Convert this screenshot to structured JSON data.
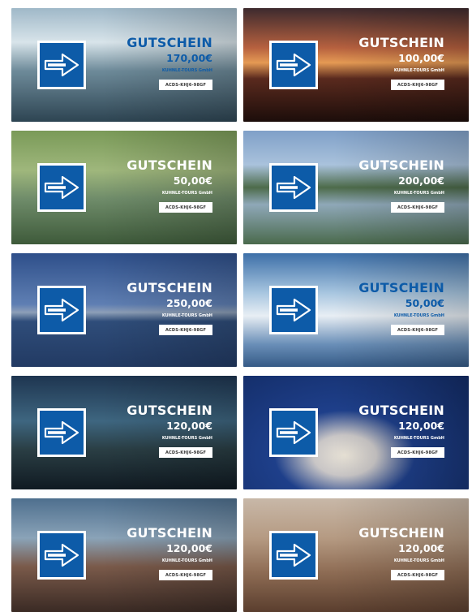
{
  "cards": [
    {
      "title": "GUTSCHEIN",
      "amount": "170,00€",
      "company": "KUHNLE-TOURS GmbH",
      "code": "ACDS-KHJ6-98GF",
      "text_color": "#0d5ba8",
      "bg": "linear-gradient(180deg,#9fb8c8 0%,#d8e4ea 30%,#6e8b9a 55%,#2d4452 100%)"
    },
    {
      "title": "GUTSCHEIN",
      "amount": "100,00€",
      "company": "KUHNLE-TOURS GmbH",
      "code": "ACDS-KHJ6-98GF",
      "text_color": "#ffffff",
      "bg": "linear-gradient(180deg,#3d2a2e 0%,#b7613f 35%,#e59a54 48%,#5a2a1e 62%,#1c0d0a 100%)"
    },
    {
      "title": "GUTSCHEIN",
      "amount": "50,00€",
      "company": "KUHNLE-TOURS GmbH",
      "code": "ACDS-KHJ6-98GF",
      "text_color": "#ffffff",
      "bg": "linear-gradient(180deg,#7a9a58 0%,#9fb77c 35%,#6f8c6a 60%,#3e5a3a 100%)"
    },
    {
      "title": "GUTSCHEIN",
      "amount": "200,00€",
      "company": "KUHNLE-TOURS GmbH",
      "code": "ACDS-KHJ6-98GF",
      "text_color": "#ffffff",
      "bg": "linear-gradient(180deg,#7fa0c8 0%,#a9c2dc 30%,#4d6b4a 50%,#8fa8b8 65%,#4a6a4c 100%)"
    },
    {
      "title": "GUTSCHEIN",
      "amount": "250,00€",
      "company": "KUHNLE-TOURS GmbH",
      "code": "ACDS-KHJ6-98GF",
      "text_color": "#ffffff",
      "bg": "linear-gradient(180deg,#2e4f8a 0%,#5f7fb3 45%,#8d9fb8 52%,#2f4d7a 60%,#223a63 100%)"
    },
    {
      "title": "GUTSCHEIN",
      "amount": "50,00€",
      "company": "KUHNLE-TOURS GmbH",
      "code": "ACDS-KHJ6-98GF",
      "text_color": "#0d5ba8",
      "bg": "linear-gradient(180deg,#3d6fa8 0%,#a8c6e0 35%,#e8eef4 55%,#6a8fb8 80%,#355a86 100%)"
    },
    {
      "title": "GUTSCHEIN",
      "amount": "120,00€",
      "company": "KUHNLE-TOURS GmbH",
      "code": "ACDS-KHJ6-98GF",
      "text_color": "#ffffff",
      "bg": "linear-gradient(180deg,#1e3550 0%,#3e6680 40%,#2a3e44 65%,#101a22 100%)"
    },
    {
      "title": "GUTSCHEIN",
      "amount": "120,00€",
      "company": "KUHNLE-TOURS GmbH",
      "code": "ACDS-KHJ6-98GF",
      "text_color": "#ffffff",
      "bg": "radial-gradient(ellipse at 45% 70%,#e8e2d6 0%,#c9c6c6 18%,#1e3f8a 40%,#132c66 100%)"
    },
    {
      "title": "GUTSCHEIN",
      "amount": "120,00€",
      "company": "KUHNLE-TOURS GmbH",
      "code": "ACDS-KHJ6-98GF",
      "text_color": "#ffffff",
      "bg": "linear-gradient(180deg,#4e6f8e 0%,#8aa3b8 35%,#7a5a4a 60%,#3a2a24 100%)"
    },
    {
      "title": "GUTSCHEIN",
      "amount": "120,00€",
      "company": "KUHNLE-TOURS GmbH",
      "code": "ACDS-KHJ6-98GF",
      "text_color": "#ffffff",
      "bg": "linear-gradient(180deg,#c8b8a8 0%,#b59a82 35%,#8e6c54 65%,#5a3e2e 100%)"
    }
  ]
}
